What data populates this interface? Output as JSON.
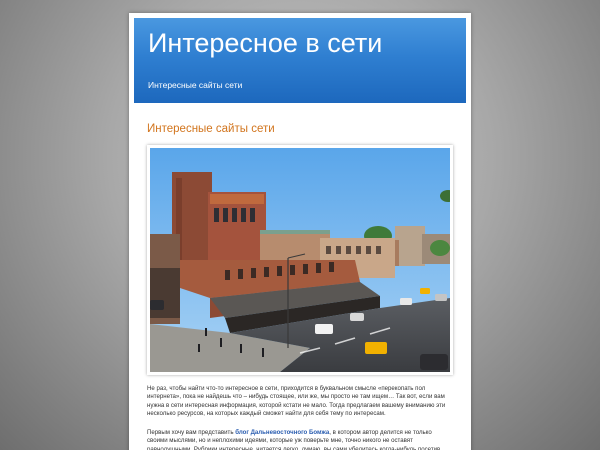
{
  "header": {
    "title": "Интересное в сети",
    "description": "Интересные сайты сети"
  },
  "post": {
    "title": "Интересные сайты сети",
    "paragraph1": "Не раз, чтобы найти что-то интересное в сети, приходится в буквальном смысле «перекопать пол интернета», пока не найдешь что – нибудь стоящее, или же, мы просто не там ищем… Так вот, если вам нужна в сети интересная информация, которой кстати не мало. Тогда предлагаем вашему вниманию эти несколько ресурсов, на которых каждый сможет найти для себя тему по интересам.",
    "paragraph2_before": "Первым хочу вам представить ",
    "paragraph2_link": "блог Дальневосточного Бомжа",
    "paragraph2_after": ", в котором автор делится не только своими мыслями, но и неплохими идеями, которые уж поверьте мне, точно никого не оставят равнодушными. Рубрики интересные, читается легко, думаю, вы сами убедитесь когда-нибудь посетив."
  },
  "photo": {
    "caption": ""
  }
}
